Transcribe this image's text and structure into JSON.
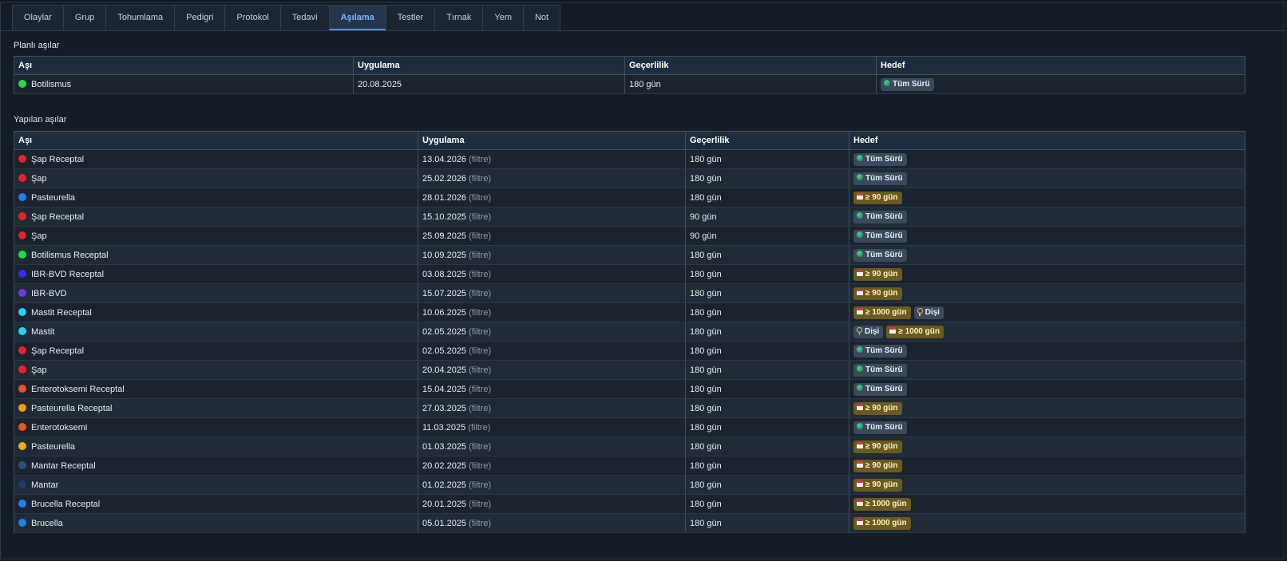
{
  "tabs": [
    "Olaylar",
    "Grup",
    "Tohumlama",
    "Pedigri",
    "Protokol",
    "Tedavi",
    "Aşılama",
    "Testler",
    "Tırnak",
    "Yem",
    "Not"
  ],
  "active_tab": 6,
  "planned": {
    "title": "Planlı aşılar",
    "columns": [
      "Aşı",
      "Uygulama",
      "Geçerlilik",
      "Hedef"
    ],
    "rows": [
      {
        "name": "Botilismus",
        "color": "#22dd44",
        "date": "20.08.2025",
        "validity": "180 gün",
        "targets": [
          {
            "type": "herd",
            "label": "Tüm Sürü"
          }
        ]
      }
    ]
  },
  "done": {
    "title": "Yapılan aşılar",
    "filter_label": "(filtre)",
    "columns": [
      "Aşı",
      "Uygulama",
      "Geçerlilik",
      "Hedef"
    ],
    "rows": [
      {
        "name": "Şap Receptal",
        "color": "#e8202a",
        "date": "13.04.2026",
        "validity": "180 gün",
        "targets": [
          {
            "type": "herd",
            "label": "Tüm Sürü"
          }
        ]
      },
      {
        "name": "Şap",
        "color": "#e8202a",
        "date": "25.02.2026",
        "validity": "180 gün",
        "targets": [
          {
            "type": "herd",
            "label": "Tüm Sürü"
          }
        ]
      },
      {
        "name": "Pasteurella",
        "color": "#1e7ff0",
        "date": "28.01.2026",
        "validity": "180 gün",
        "targets": [
          {
            "type": "days",
            "label": "≥ 90 gün"
          }
        ]
      },
      {
        "name": "Şap Receptal",
        "color": "#e8202a",
        "date": "15.10.2025",
        "validity": "90 gün",
        "targets": [
          {
            "type": "herd",
            "label": "Tüm Sürü"
          }
        ]
      },
      {
        "name": "Şap",
        "color": "#e8202a",
        "date": "25.09.2025",
        "validity": "90 gün",
        "targets": [
          {
            "type": "herd",
            "label": "Tüm Sürü"
          }
        ]
      },
      {
        "name": "Botilismus Receptal",
        "color": "#22dd44",
        "date": "10.09.2025",
        "validity": "180 gün",
        "targets": [
          {
            "type": "herd",
            "label": "Tüm Sürü"
          }
        ]
      },
      {
        "name": "IBR-BVD Receptal",
        "color": "#3a2ae8",
        "date": "03.08.2025",
        "validity": "180 gün",
        "targets": [
          {
            "type": "days",
            "label": "≥ 90 gün"
          }
        ]
      },
      {
        "name": "IBR-BVD",
        "color": "#6a3ae0",
        "date": "15.07.2025",
        "validity": "180 gün",
        "targets": [
          {
            "type": "days",
            "label": "≥ 90 gün"
          }
        ]
      },
      {
        "name": "Mastit Receptal",
        "color": "#22d4f0",
        "date": "10.06.2025",
        "validity": "180 gün",
        "targets": [
          {
            "type": "days",
            "label": "≥ 1000 gün"
          },
          {
            "type": "sex",
            "label": "Dişi"
          }
        ]
      },
      {
        "name": "Mastit",
        "color": "#22d4f0",
        "date": "02.05.2025",
        "validity": "180 gün",
        "targets": [
          {
            "type": "sex",
            "label": "Dişi"
          },
          {
            "type": "days",
            "label": "≥ 1000 gün"
          }
        ]
      },
      {
        "name": "Şap Receptal",
        "color": "#e8202a",
        "date": "02.05.2025",
        "validity": "180 gün",
        "targets": [
          {
            "type": "herd",
            "label": "Tüm Sürü"
          }
        ]
      },
      {
        "name": "Şap",
        "color": "#e8202a",
        "date": "20.04.2025",
        "validity": "180 gün",
        "targets": [
          {
            "type": "herd",
            "label": "Tüm Sürü"
          }
        ]
      },
      {
        "name": "Enterotoksemi Receptal",
        "color": "#f05020",
        "date": "15.04.2025",
        "validity": "180 gün",
        "targets": [
          {
            "type": "herd",
            "label": "Tüm Sürü"
          }
        ]
      },
      {
        "name": "Pasteurella Receptal",
        "color": "#f59a18",
        "date": "27.03.2025",
        "validity": "180 gün",
        "targets": [
          {
            "type": "days",
            "label": "≥ 90 gün"
          }
        ]
      },
      {
        "name": "Enterotoksemi",
        "color": "#f05020",
        "date": "11.03.2025",
        "validity": "180 gün",
        "targets": [
          {
            "type": "herd",
            "label": "Tüm Sürü"
          }
        ]
      },
      {
        "name": "Pasteurella",
        "color": "#f5a818",
        "date": "01.03.2025",
        "validity": "180 gün",
        "targets": [
          {
            "type": "days",
            "label": "≥ 90 gün"
          }
        ]
      },
      {
        "name": "Mantar Receptal",
        "color": "#2e4c78",
        "date": "20.02.2025",
        "validity": "180 gün",
        "targets": [
          {
            "type": "days",
            "label": "≥ 90 gün"
          }
        ]
      },
      {
        "name": "Mantar",
        "color": "#1e3c72",
        "date": "01.02.2025",
        "validity": "180 gün",
        "targets": [
          {
            "type": "days",
            "label": "≥ 90 gün"
          }
        ]
      },
      {
        "name": "Brucella Receptal",
        "color": "#1e7ff0",
        "date": "20.01.2025",
        "validity": "180 gün",
        "targets": [
          {
            "type": "days",
            "label": "≥ 1000 gün"
          }
        ]
      },
      {
        "name": "Brucella",
        "color": "#1e7ff0",
        "date": "05.01.2025",
        "validity": "180 gün",
        "targets": [
          {
            "type": "days",
            "label": "≥ 1000 gün"
          }
        ]
      }
    ]
  }
}
